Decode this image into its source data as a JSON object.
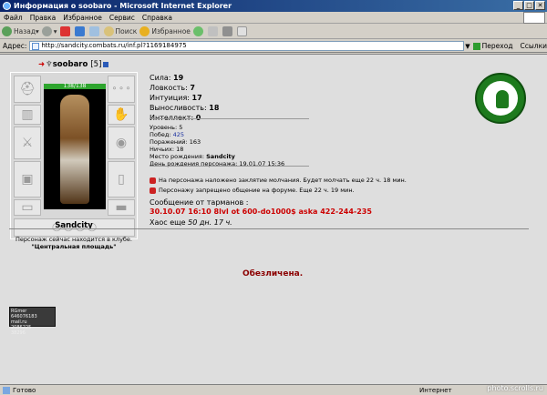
{
  "window": {
    "title": "Информация о soobaro - Microsoft Internet Explorer"
  },
  "menu": [
    "Файл",
    "Правка",
    "Избранное",
    "Сервис",
    "Справка"
  ],
  "toolbar": {
    "back": "Назад",
    "search": "Поиск",
    "favorites": "Избранное"
  },
  "address": {
    "label": "Адрес:",
    "url": "http://sandcity.combats.ru/inf.pl?1169184975",
    "go": "Переход",
    "links": "Ссылки"
  },
  "character": {
    "nick": "soobaro",
    "level_badge": "[5]",
    "hp": "138/138",
    "city": "Sandcity",
    "club_line": "Персонаж сейчас находится в клубе.",
    "club_place": "\"Центральная площадь\""
  },
  "stats": [
    {
      "label": "Сила:",
      "value": "19"
    },
    {
      "label": "Ловкость:",
      "value": "7"
    },
    {
      "label": "Интуиция:",
      "value": "17"
    },
    {
      "label": "Выносливость:",
      "value": "18"
    },
    {
      "label": "Интеллект:",
      "value": "0"
    }
  ],
  "details": {
    "level": "Уровень: 5",
    "wins_label": "Побед:",
    "wins": "425",
    "losses": "Поражений: 163",
    "draws": "Ничьих: 18",
    "birth_label": "Место рождения:",
    "birth_place": "Sandcity",
    "birthday": "День рождения персонажа: 19.01.07 15:36"
  },
  "notices": {
    "silence": "На персонажа наложено заклятие молчания. Будет молчать еще 22 ч. 18 мин.",
    "forum": "Персонажу запрещено общение на форуме. Еще 22 ч. 19 мин."
  },
  "message": {
    "header": "Сообщение от тарманов :",
    "text": "30.10.07 16:10 8lvl ot 600-do1000$ aska 422-244-235"
  },
  "chaos": {
    "prefix": "Хаос еще",
    "time": "50 дн. 17 ч."
  },
  "status": {
    "blocked": "Обезличена."
  },
  "counter": {
    "line1": "RGmer 646076183",
    "line2": "mail.ru",
    "line3": "2086225",
    "line4": "38296"
  },
  "statusbar": {
    "text": "Готово",
    "zone": "Интернет",
    "watermark": "photo.scrolls.ru"
  }
}
